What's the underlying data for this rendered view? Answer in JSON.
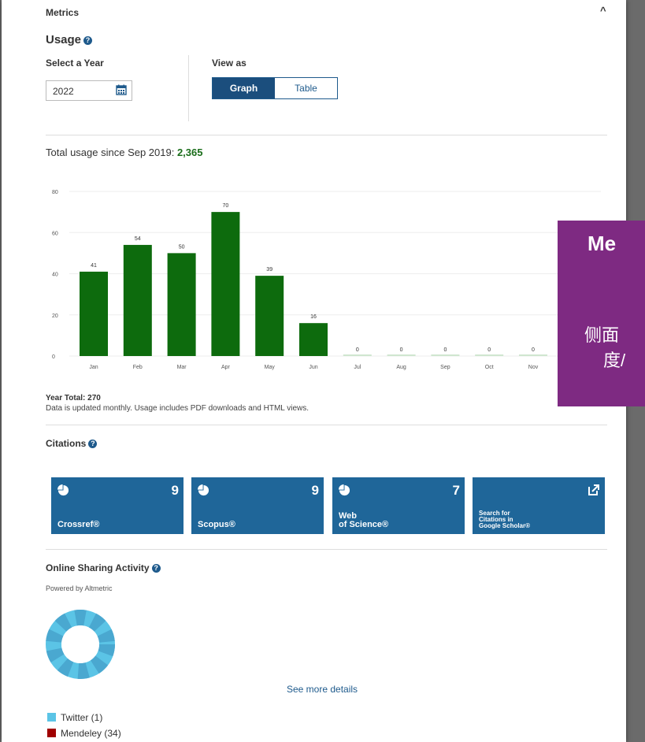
{
  "metrics": {
    "title": "Metrics"
  },
  "usage": {
    "title": "Usage",
    "select_year_label": "Select a Year",
    "year_value": "2022",
    "view_as_label": "View as",
    "view_options": [
      "Graph",
      "Table"
    ],
    "view_selected": "Graph",
    "total_label": "Total usage since Sep 2019: ",
    "total_value": "2,365",
    "year_total": "Year Total: 270",
    "note": "Data is updated monthly. Usage includes PDF downloads and HTML views."
  },
  "chart_data": {
    "type": "bar",
    "categories": [
      "Jan",
      "Feb",
      "Mar",
      "Apr",
      "May",
      "Jun",
      "Jul",
      "Aug",
      "Sep",
      "Oct",
      "Nov"
    ],
    "values": [
      41,
      54,
      50,
      70,
      39,
      16,
      0,
      0,
      0,
      0,
      0
    ],
    "ylim": [
      0,
      80
    ],
    "yticks": [
      0,
      20,
      40,
      60,
      80
    ],
    "grid": true,
    "color": "#0d6b0d"
  },
  "citations": {
    "title": "Citations",
    "tiles": [
      {
        "name": "Crossref®",
        "count": "9"
      },
      {
        "name": "Scopus®",
        "count": "9"
      },
      {
        "name_line1": "Web",
        "name_line2": "of Science®",
        "count": "7"
      },
      {
        "name_line1": "Search for",
        "name_line2": "Citations in",
        "name_line3": "Google Scholar®"
      }
    ]
  },
  "sharing": {
    "title": "Online Sharing Activity",
    "powered_by": "Powered by Altmetric",
    "see_more": "See more details",
    "legend": [
      {
        "label": "Twitter (1)",
        "color": "#5bc4e6"
      },
      {
        "label": "Mendeley (34)",
        "color": "#a00000"
      }
    ]
  },
  "overlay": {
    "title": "Me",
    "line1": "侧面",
    "line2": "度/",
    "color": "#7e2a82"
  }
}
